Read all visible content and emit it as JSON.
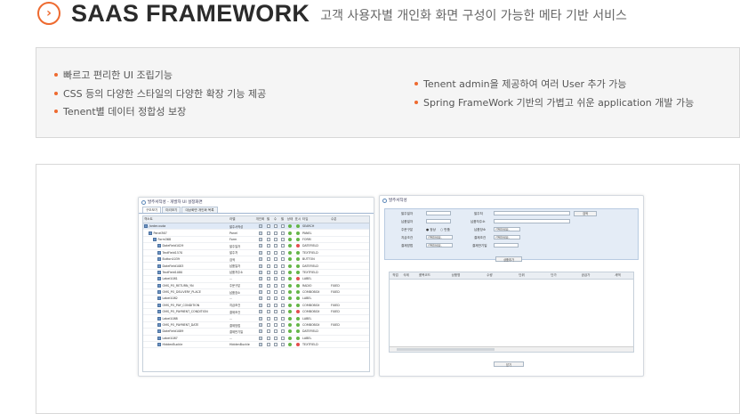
{
  "header": {
    "title": "SAAS FRAMEWORK",
    "subtitle": "고객 사용자별 개인화 화면 구성이 가능한 메타 기반 서비스"
  },
  "features": {
    "left": [
      "빠르고 편리한 UI 조립기능",
      "CSS 등의 다양한 스타일의 다양한 확장 기능 제공",
      "Tenent별 데이터 정합성 보장"
    ],
    "right": [
      "Tenent admin을 제공하여 여러 User 추가 가능",
      "Spring FrameWork 기반의 가볍고 쉬운 application 개발 가능"
    ]
  },
  "colors": {
    "accent": "#ee6a2f"
  },
  "designer": {
    "title": "발주서작성 - 개발자 UI 설정화면",
    "tabs": [
      "구조보기",
      "미리보기",
      "대상화면 개인화 목록"
    ],
    "columns": [
      "객소트",
      "라벨",
      "개인화",
      "필",
      "수",
      "필",
      "상태",
      "표시",
      "타입",
      "수분"
    ],
    "rows": [
      {
        "name": "/order.xuda",
        "label": "발주서작성",
        "type": "SEARCH",
        "fmt": "",
        "indent": 0
      },
      {
        "name": "Panel367",
        "label": "Panel",
        "type": "PANEL",
        "fmt": "",
        "indent": 1
      },
      {
        "name": "Form368",
        "label": "Form",
        "type": "FORM",
        "fmt": "",
        "indent": 2
      },
      {
        "name": "DateField1029",
        "label": "발주일자",
        "type": "DATEFIELD",
        "fmt": "",
        "indent": 3
      },
      {
        "name": "TextField1570",
        "label": "발주처",
        "type": "TEXTFIELD",
        "fmt": "",
        "indent": 3
      },
      {
        "name": "Button1039",
        "label": "검색",
        "type": "BUTTON",
        "fmt": "",
        "indent": 3
      },
      {
        "name": "DateField1083",
        "label": "납품일자",
        "type": "DATEFIELD",
        "fmt": "",
        "indent": 3
      },
      {
        "name": "TextField1080",
        "label": "납품처주소",
        "type": "TEXTFIELD",
        "fmt": "",
        "indent": 3
      },
      {
        "name": "Label1081",
        "label": "...",
        "type": "LABEL",
        "fmt": "",
        "indent": 3
      },
      {
        "name": "OMS_PO_RETURN_YN",
        "label": "주문구분",
        "type": "RADIO",
        "fmt": "FIXED",
        "indent": 3
      },
      {
        "name": "OMS_PO_DELIVERY_PLACE",
        "label": "납품장소",
        "type": "COMBOBOX",
        "fmt": "FIXED",
        "indent": 3
      },
      {
        "name": "Label1082",
        "label": "...",
        "type": "LABEL",
        "fmt": "",
        "indent": 3
      },
      {
        "name": "OMS_PO_PAY_CONDITION",
        "label": "지급조건",
        "type": "COMBOBOX",
        "fmt": "FIXED",
        "indent": 3
      },
      {
        "name": "OMS_PO_PAYMENT_CONDITION",
        "label": "결제조건",
        "type": "COMBOBOX",
        "fmt": "FIXED",
        "indent": 3
      },
      {
        "name": "Label1088",
        "label": "...",
        "type": "LABEL",
        "fmt": "",
        "indent": 3
      },
      {
        "name": "OMS_PO_PAYMENT_DATE",
        "label": "결제방법",
        "type": "COMBOBOX",
        "fmt": "FIXED",
        "indent": 3
      },
      {
        "name": "DateField1089",
        "label": "결제만기일",
        "type": "DATEFIELD",
        "fmt": "",
        "indent": 3
      },
      {
        "name": "Label1087",
        "label": "...",
        "type": "LABEL",
        "fmt": "",
        "indent": 3
      },
      {
        "name": "HiddenBuckle",
        "label": "HiddenBuckle",
        "type": "TEXTFIELD",
        "fmt": "",
        "indent": 3
      }
    ]
  },
  "preview": {
    "title": "발주서작성",
    "fields": {
      "order_date": "발주일자",
      "vendor": "발주처",
      "search": "검색",
      "delivery_date": "납품일자",
      "delivery_addr": "납품처주소",
      "order_type": "주문구분",
      "order_type_normal": "정상",
      "order_type_return": "반품",
      "delivery_place": "납품장소",
      "pay_condition": "지급조건",
      "payment_condition": "결제조건",
      "payment_method": "결제방법",
      "payment_due": "결제만기일",
      "select_placeholder": "선택하세요."
    },
    "add_button": "상품추가",
    "grid_columns": [
      "작업",
      "삭제",
      "품목코드",
      "상품명",
      "수량",
      "단위",
      "단가",
      "공급가",
      "세액"
    ],
    "close_button": "닫기"
  }
}
